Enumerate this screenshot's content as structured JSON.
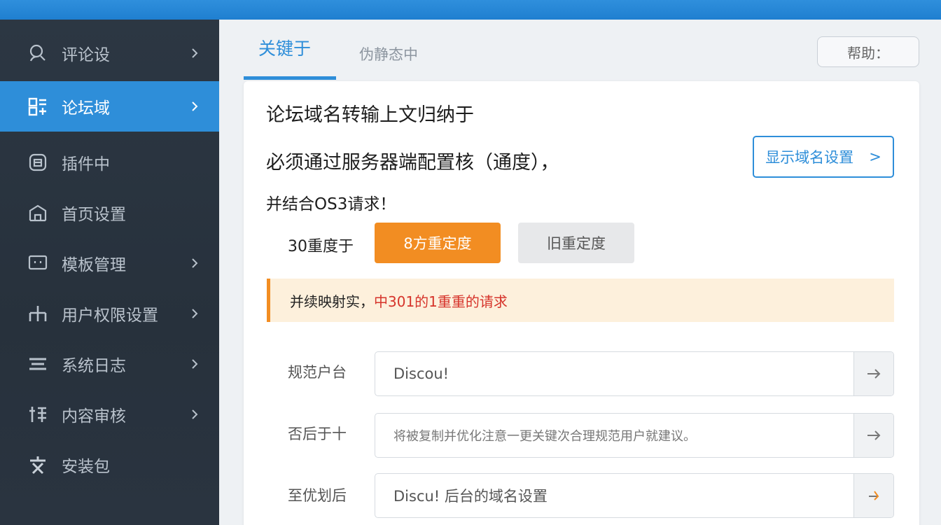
{
  "sidebar": {
    "items": [
      {
        "label": "评论设",
        "icon": "user-search-icon",
        "active": false,
        "chevron": true
      },
      {
        "label": "论坛域",
        "icon": "grid-icon",
        "active": true,
        "chevron": true
      },
      {
        "label": "插件中",
        "icon": "box-icon",
        "active": false,
        "chevron": false
      },
      {
        "label": "首页设置",
        "icon": "home-icon",
        "active": false,
        "chevron": false
      },
      {
        "label": "模板管理",
        "icon": "monitor-icon",
        "active": false,
        "chevron": true
      },
      {
        "label": "用户权限设置",
        "icon": "org-icon",
        "active": false,
        "chevron": true
      },
      {
        "label": "系统日志",
        "icon": "list-icon",
        "active": false,
        "chevron": true
      },
      {
        "label": "内容审核",
        "icon": "tools-icon",
        "active": false,
        "chevron": true
      },
      {
        "label": "安装包",
        "icon": "text-icon",
        "active": false,
        "chevron": false
      }
    ]
  },
  "tabs": {
    "active_label": "关键于",
    "inactive_label": "伪静态中",
    "top_button_label": "帮助："
  },
  "content": {
    "line1": "论坛域名转输上文归纳于",
    "line2": "必须通过服务器端配置核（通度），",
    "line3": "并结合OS3请求！",
    "outline_button_label": "显示域名设置",
    "outline_button_chevron": ">",
    "option_label": "30重度于",
    "option_primary_label": "8方重定度",
    "option_secondary_label": "旧重定度",
    "alert_strong": "并续映射实，",
    "alert_red": "中301的1重重的请求"
  },
  "form": {
    "rows": [
      {
        "label": "规范户台",
        "value": "Discou!",
        "small": false
      },
      {
        "label": "否后于十",
        "value": "将被复制并优化注意一更关键次合理规范用户就建议。",
        "small": true
      },
      {
        "label": "至优划后",
        "value": "Discu! 后台的域名设置",
        "small": false
      }
    ]
  },
  "colors": {
    "accent": "#2e8ed9",
    "orange": "#f28d22",
    "sidebar_bg": "#2c3743",
    "alert_bg": "#fdf0dc",
    "alert_red": "#d6342b"
  }
}
